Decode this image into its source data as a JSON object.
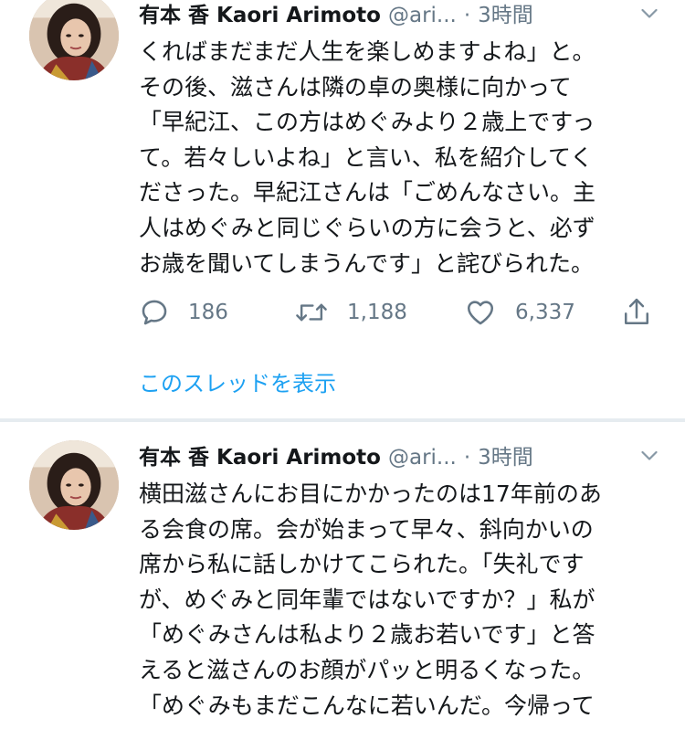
{
  "tweets": [
    {
      "author_name": "有本 香 Kaori Arimoto",
      "handle": "@ari...",
      "separator": "·",
      "time": "3時間",
      "lines": [
        "くればまだまだ人生を楽しめますよね」と。",
        "その後、滋さんは隣の卓の奥様に向かって",
        "「早紀江、この方はめぐみより２歳上ですっ",
        "て。若々しいよね」と言い、私を紹介してく",
        "ださった。早紀江さんは「ごめんなさい。主",
        "人はめぐみと同じぐらいの方に会うと、必ず",
        "お歳を聞いてしまうんです」と詫びられた。"
      ],
      "stats": {
        "replies": "186",
        "retweets": "1,188",
        "likes": "6,337"
      },
      "thread_link": "このスレッドを表示"
    },
    {
      "author_name": "有本 香 Kaori Arimoto",
      "handle": "@ari...",
      "separator": "·",
      "time": "3時間",
      "lines": [
        "横田滋さんにお目にかかったのは17年前のあ",
        "る会食の席。会が始まって早々、斜向かいの",
        "席から私に話しかけてこられた。「失礼です",
        "が、めぐみと同年輩ではないですか？」私が",
        "「めぐみさんは私より２歳お若いです」と答",
        "えると滋さんのお顔がパッと明るくなった。",
        "「めぐみもまだこんなに若いんだ。今帰って"
      ]
    }
  ],
  "icons": {
    "reply": "reply-icon",
    "retweet": "retweet-icon",
    "like": "heart-icon",
    "share": "share-icon",
    "menu": "chevron-down-icon"
  },
  "colors": {
    "text": "#14171a",
    "secondary": "#657786",
    "link": "#1da1f2",
    "divider": "#e6ecf0"
  }
}
